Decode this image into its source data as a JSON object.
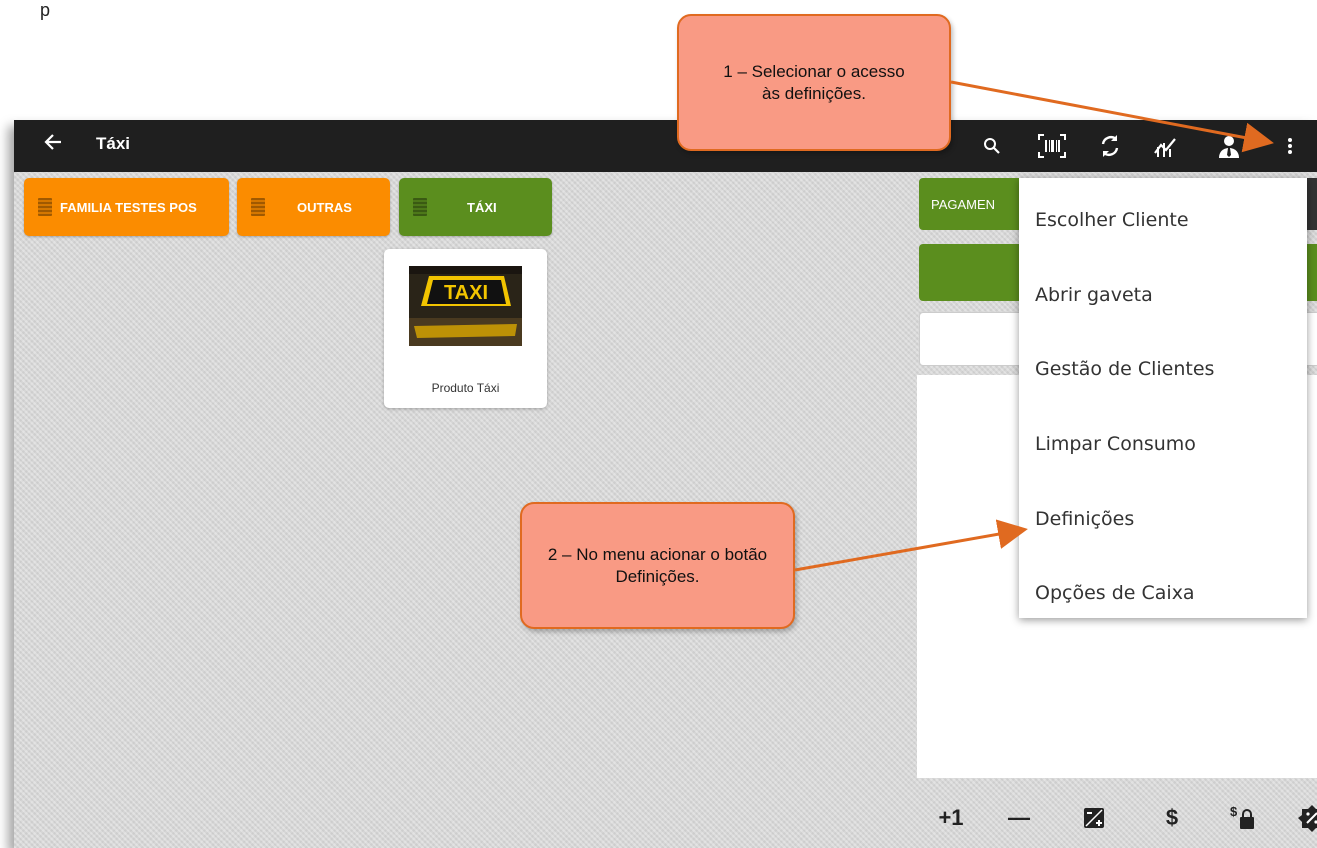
{
  "doc_fragment": "p",
  "appbar": {
    "title": "Táxi",
    "icons": [
      "back-arrow-icon",
      "search-icon",
      "barcode-scan-icon",
      "sync-icon",
      "chart-icon",
      "user-tie-icon",
      "more-vert-icon"
    ]
  },
  "categories": [
    {
      "label": "FAMILIA TESTES POS",
      "color": "#fb8c00"
    },
    {
      "label": "OUTRAS",
      "color": "#fb8c00"
    },
    {
      "label": "TÁXI",
      "color": "#5b8e1e"
    }
  ],
  "product": {
    "label": "Produto Táxi",
    "sign_text": "TAXI"
  },
  "right_panel": {
    "payment_label": "PAGAMEN"
  },
  "menu": {
    "items": [
      "Escolher Cliente",
      "Abrir gaveta",
      "Gestão de Clientes",
      "Limpar Consumo",
      "Definições",
      "Opções de Caixa"
    ]
  },
  "bottom_bar": {
    "plus_one": "+1",
    "minus": "—",
    "dollar": "$"
  },
  "callouts": {
    "step1": "1 – Selecionar o acesso às definições.",
    "step2": "2 – No menu acionar o botão Definições."
  },
  "colors": {
    "accent_orange": "#fb8c00",
    "accent_green": "#5b8e1e",
    "callout_fill": "#f99a84",
    "callout_border": "#e06a20"
  }
}
